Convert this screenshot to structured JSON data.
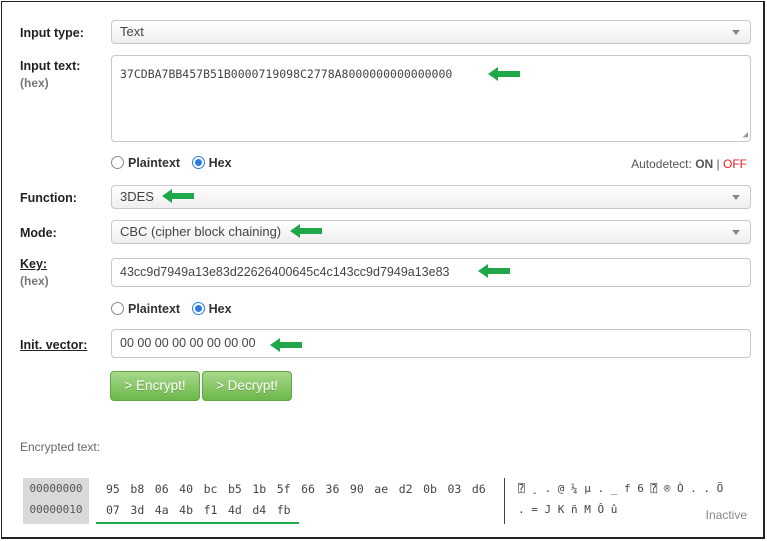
{
  "form": {
    "input_type": {
      "label": "Input type:",
      "value": "Text"
    },
    "input_text": {
      "label": "Input text:",
      "sublabel": "(hex)",
      "value": "37CDBA7BB457B51B0000719098C2778A8000000000000000"
    },
    "input_format": {
      "options": [
        "Plaintext",
        "Hex"
      ],
      "selected": "Hex"
    },
    "autodetect": {
      "label": "Autodetect:",
      "on": "ON",
      "separator": "|",
      "off": "OFF",
      "off_color": "#e02020"
    },
    "function": {
      "label": "Function:",
      "value": "3DES"
    },
    "mode": {
      "label": "Mode:",
      "value": "CBC (cipher block chaining)"
    },
    "key": {
      "label": "Key:",
      "sublabel": "(hex)",
      "value": "43cc9d7949a13e83d22626400645c4c143cc9d7949a13e83"
    },
    "key_format": {
      "options": [
        "Plaintext",
        "Hex"
      ],
      "selected": "Hex"
    },
    "iv": {
      "label": "Init. vector:",
      "value": "00 00 00 00 00 00 00 00"
    },
    "buttons": {
      "encrypt": "> Encrypt!",
      "decrypt": "> Decrypt!"
    }
  },
  "output": {
    "label": "Encrypted text:",
    "rows": [
      {
        "offset": "00000000",
        "bytes": [
          "95",
          "b8",
          "06",
          "40",
          "bc",
          "b5",
          "1b",
          "5f",
          "66",
          "36",
          "90",
          "ae",
          "d2",
          "0b",
          "03",
          "d6"
        ],
        "ascii": "⍰ ¸ . @ ¼ µ . _ f 6 ⍰ ® Ò . . Ö"
      },
      {
        "offset": "00000010",
        "bytes": [
          "07",
          "3d",
          "4a",
          "4b",
          "f1",
          "4d",
          "d4",
          "fb"
        ],
        "ascii": ". = J K ñ M Ô û"
      }
    ],
    "status": "Inactive"
  },
  "colors": {
    "arrow": "#1ea84a",
    "accent_blue": "#2a7de1",
    "button_green": "#6cb84a"
  }
}
